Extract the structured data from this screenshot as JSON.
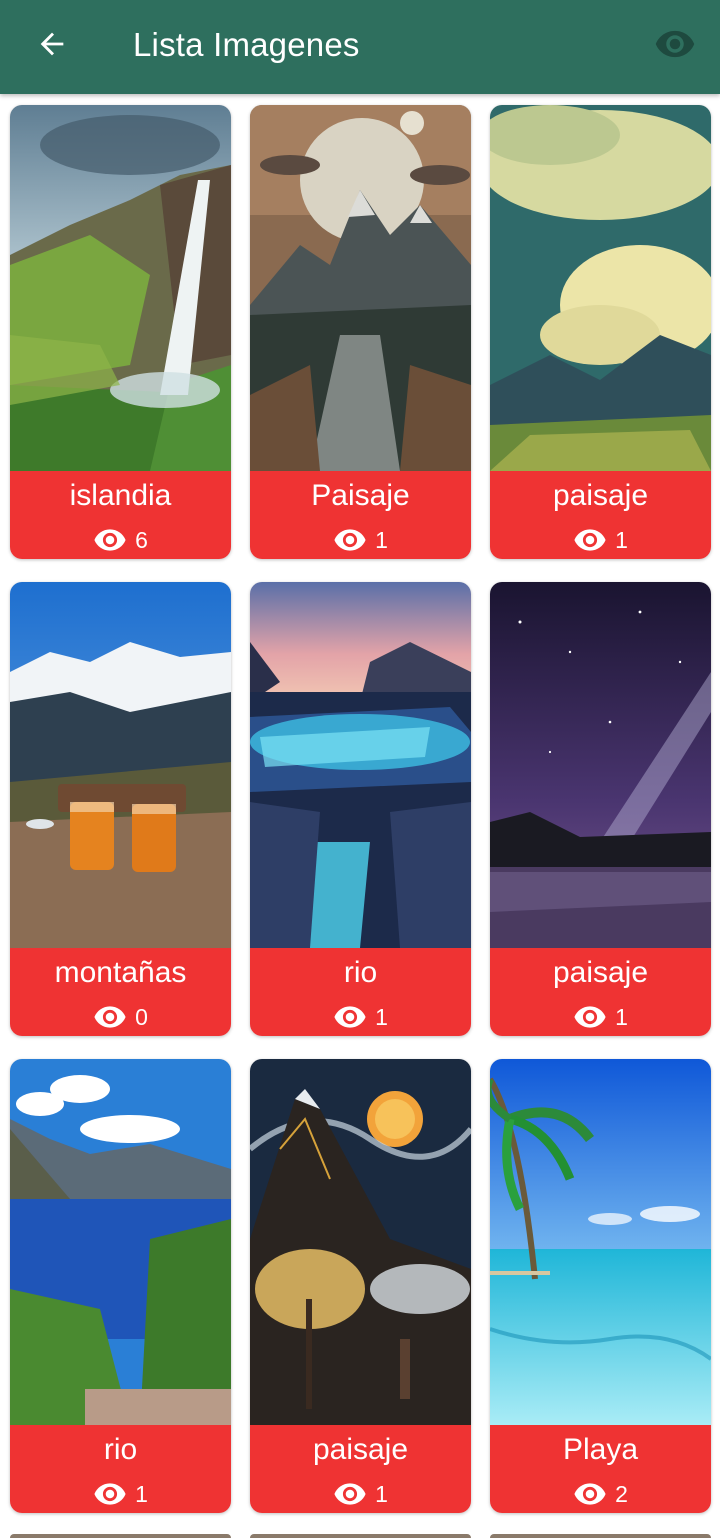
{
  "appbar": {
    "title": "Lista Imagenes",
    "back_icon": "arrow-left-icon",
    "action_icon": "eye-icon",
    "background": "#2e6f5e"
  },
  "cards": [
    {
      "label": "islandia",
      "views": "6",
      "scene": "waterfall"
    },
    {
      "label": "Paisaje",
      "views": "1",
      "scene": "moon-mountains"
    },
    {
      "label": "paisaje",
      "views": "1",
      "scene": "clouds-valley"
    },
    {
      "label": "montañas",
      "views": "0",
      "scene": "snow-mountains-tea"
    },
    {
      "label": "rio",
      "views": "1",
      "scene": "glowing-river"
    },
    {
      "label": "paisaje",
      "views": "1",
      "scene": "galaxy-lake"
    },
    {
      "label": "rio",
      "views": "1",
      "scene": "blue-lake"
    },
    {
      "label": "paisaje",
      "views": "1",
      "scene": "starry-mountain"
    },
    {
      "label": "Playa",
      "views": "2",
      "scene": "beach-palm"
    }
  ],
  "colors": {
    "card_footer": "#ef3333",
    "footer_text": "#ffffff"
  }
}
